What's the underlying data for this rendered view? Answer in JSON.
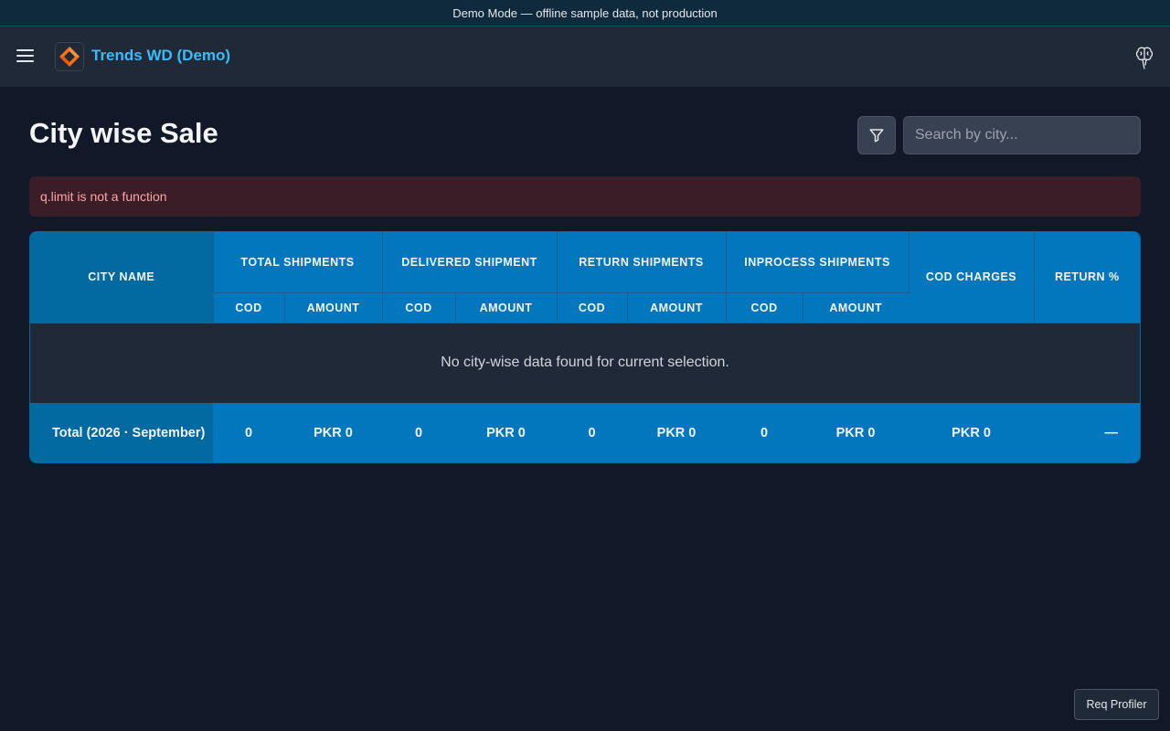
{
  "banner": {
    "text": "Demo Mode — offline sample data, not production"
  },
  "header": {
    "brand": "Trends WD (Demo)",
    "menu_icon": "hamburger-icon",
    "profile_icon": "brain-icon"
  },
  "page": {
    "title": "City wise Sale"
  },
  "search": {
    "placeholder": "Search by city..."
  },
  "error": {
    "message": "q.limit is not a function"
  },
  "table": {
    "headers": {
      "city": "City Name",
      "total": "Total Shipments",
      "delivered": "Delivered Shipment",
      "returned": "Return Shipments",
      "inprocess": "Inprocess Shipments",
      "cod_charges": "COD Charges",
      "return_pct": "Return %"
    },
    "subheaders": {
      "cod": "COD",
      "amount": "Amount"
    },
    "empty_message": "No city-wise data found for current selection.",
    "total_row": {
      "label": "Total (2026 · September)",
      "total_cod": "0",
      "total_amount": "PKR 0",
      "delivered_cod": "0",
      "delivered_amount": "PKR 0",
      "return_cod": "0",
      "return_amount": "PKR 0",
      "inprocess_cod": "0",
      "inprocess_amount": "PKR 0",
      "cod_charges": "PKR 0",
      "return_pct": "—"
    }
  },
  "footer": {
    "req_profiler": "Req Profiler"
  },
  "colors": {
    "accent": "#38bdf8",
    "table_header": "#0277bd",
    "error_bg": "#3a1d26",
    "error_text": "#fca5a5"
  }
}
